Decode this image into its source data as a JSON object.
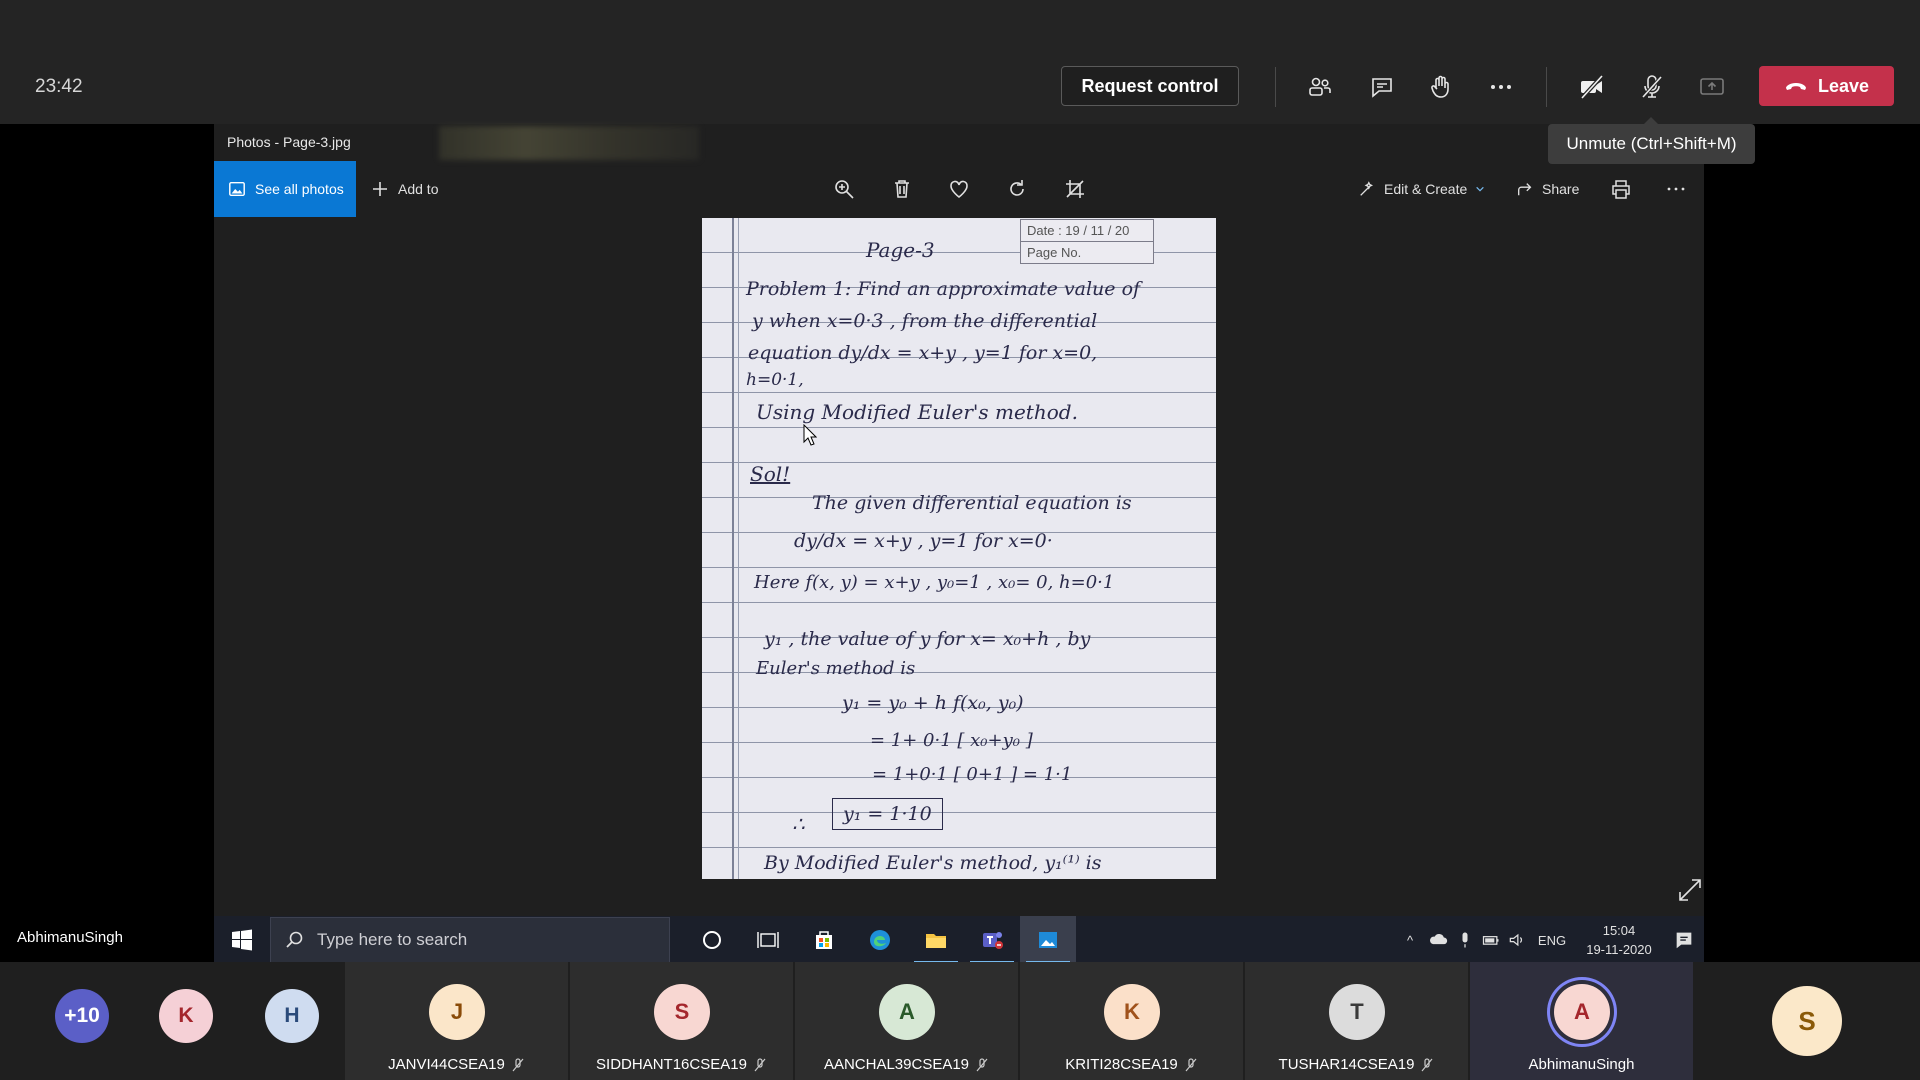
{
  "meeting": {
    "timer": "23:42",
    "request_control_label": "Request control",
    "leave_label": "Leave",
    "mute_tooltip": "Unmute (Ctrl+Shift+M)",
    "presenter_name": "AbhimanuSingh"
  },
  "photos_app": {
    "window_title": "Photos - Page-3.jpg",
    "see_all_label": "See all photos",
    "add_to_label": "Add to",
    "edit_create_label": "Edit & Create",
    "share_label": "Share"
  },
  "notebook": {
    "date_label": "Date : 19 / 11 / 20",
    "page_no_label": "Page No.",
    "lines": [
      "Page-3",
      "Problem 1: Find an approximate value of",
      "y when x=0·3 , from the differential",
      "equation  dy/dx = x+y , y=1 for x=0,",
      "h=0·1,",
      "Using Modified Euler's method.",
      "Sol!",
      "The given differential equation is",
      "dy/dx = x+y ,  y=1 for x=0·",
      "Here  f(x, y) = x+y ,  y₀=1 ,  x₀= 0, h=0·1",
      "y₁ , the value of y for x= x₀+h , by",
      "Euler's method is",
      "y₁ = y₀ + h f(x₀, y₀)",
      "= 1+ 0·1 [ x₀+y₀ ]",
      "= 1+0·1 [ 0+1 ] = 1·1",
      "∴",
      "y₁ = 1·10",
      "By Modified Euler's method, y₁⁽¹⁾ is"
    ]
  },
  "taskbar": {
    "search_placeholder": "Type here to search",
    "language": "ENG",
    "time": "15:04",
    "date": "19-11-2020"
  },
  "participants": {
    "overflow_count": "+10",
    "bubbles": [
      {
        "initial": "K",
        "bg": "#f5d0d6",
        "fg": "#a4262c"
      },
      {
        "initial": "H",
        "bg": "#cfdcf0",
        "fg": "#2a4a7a"
      }
    ],
    "tiles": [
      {
        "initial": "J",
        "name": "JANVI44CSEA19",
        "bg": "#fbe6c9",
        "fg": "#8a4b08"
      },
      {
        "initial": "S",
        "name": "SIDDHANT16CSEA19",
        "bg": "#f8d7d2",
        "fg": "#a4262c"
      },
      {
        "initial": "A",
        "name": "AANCHAL39CSEA19",
        "bg": "#d7e8d5",
        "fg": "#2a5a2a"
      },
      {
        "initial": "K",
        "name": "KRITI28CSEA19",
        "bg": "#fbe0c9",
        "fg": "#a0521b"
      },
      {
        "initial": "T",
        "name": "TUSHAR14CSEA19",
        "bg": "#dcdcdc",
        "fg": "#3a3a3a"
      },
      {
        "initial": "A",
        "name": "AbhimanuSingh",
        "bg": "#f8d7d2",
        "fg": "#a4262c"
      }
    ],
    "last": {
      "initial": "S",
      "bg": "#fbe8c9",
      "fg": "#8a5a08"
    }
  },
  "colors": {
    "leave": "#c4314b",
    "photos_accent": "#0a78d4",
    "speaking_ring": "#7f85f5"
  }
}
